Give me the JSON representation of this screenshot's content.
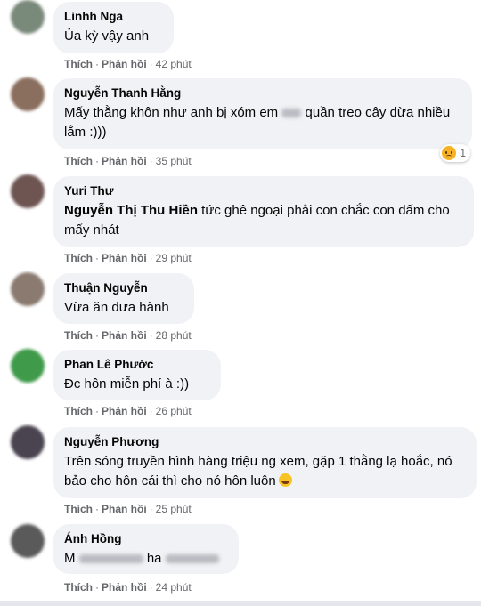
{
  "action_labels": {
    "like": "Thích",
    "reply": "Phản hồi",
    "separator": "·"
  },
  "comments": [
    {
      "author": "Linhh Nga",
      "text": "Ủa kỳ vậy anh",
      "time": "42 phút",
      "avatar_color": "#7a8a7a"
    },
    {
      "author": "Nguyễn Thanh Hằng",
      "text": "Mấy thằng khôn như anh bị xóm em",
      "text_end": "quần treo cây dừa nhiều lắm :)))",
      "time": "35 phút",
      "avatar_color": "#8a6e5e",
      "reaction": {
        "icon": "sad-emoji",
        "count": "1"
      }
    },
    {
      "author": "Yuri Thư",
      "mention": "Nguyễn Thị Thu Hiền",
      "text": "tức ghê ngoại phải con chắc con đấm cho mấy nhát",
      "time": "29 phút",
      "avatar_color": "#6e5552"
    },
    {
      "author": "Thuận Nguyễn",
      "text": "Vừa ăn dưa hành",
      "time": "28 phút",
      "avatar_color": "#8a7a70"
    },
    {
      "author": "Phan Lê Phước",
      "text": "Đc hôn miễn phí à :))",
      "time": "26 phút",
      "avatar_color": "#3f9a4a"
    },
    {
      "author": "Nguyễn Phương",
      "text": "Trên sóng truyền hình hàng triệu ng xem, gặp 1 thằng lạ hoắc, nó bảo cho hôn cái thì cho nó hôn luôn",
      "time": "25 phút",
      "avatar_color": "#4a4450",
      "emoji": "laughing-emoji"
    },
    {
      "author": "Ánh Hồng",
      "text_start": "M",
      "text_mid": "ha",
      "time": "24 phút",
      "avatar_color": "#5a5a5a"
    }
  ]
}
